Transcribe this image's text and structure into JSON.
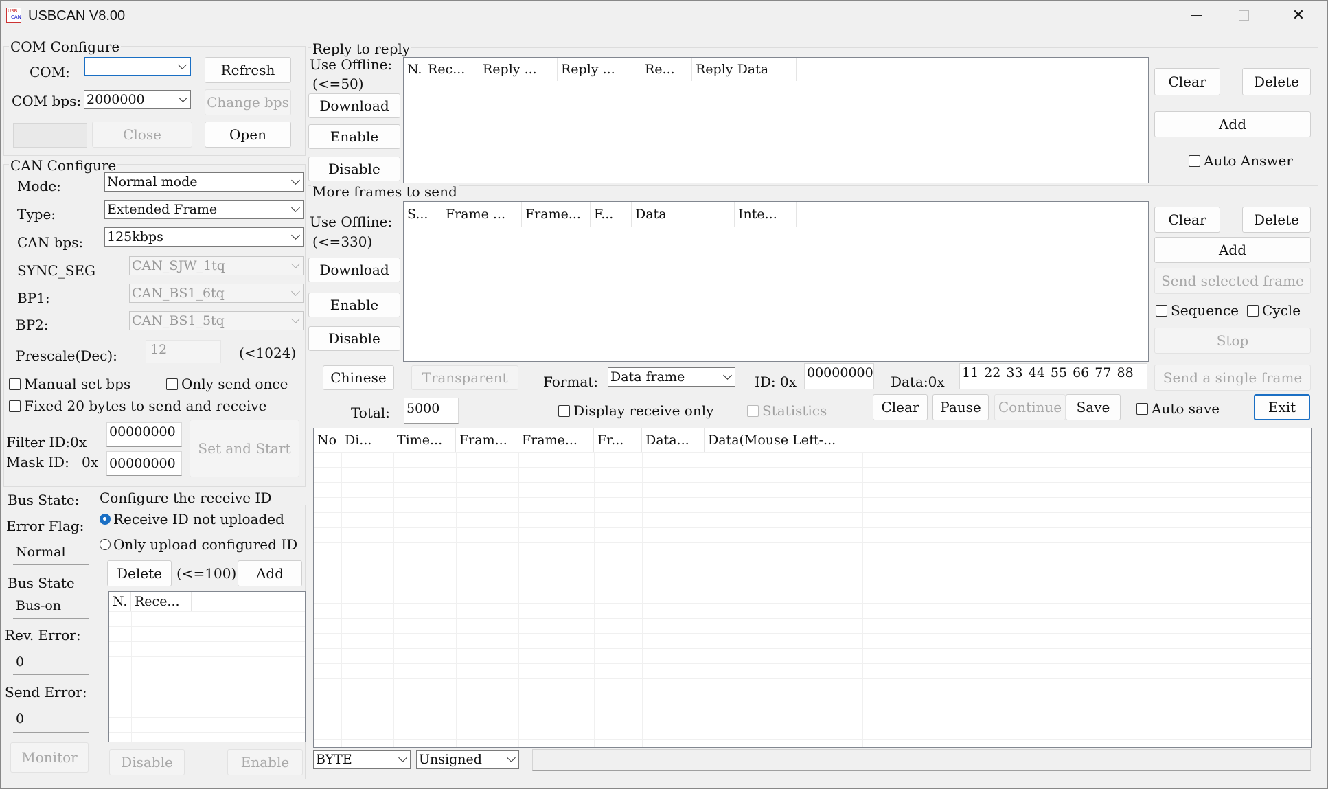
{
  "window": {
    "title": "USBCAN V8.00",
    "icon_text_top": "USB",
    "icon_text_bottom": "CAN",
    "minimize": "—",
    "maximize": "☐",
    "close": "✕"
  },
  "com": {
    "group": "COM Configure",
    "com_label": "COM:",
    "com_value": "",
    "refresh": "Refresh",
    "bps_label": "COM bps:",
    "bps_value": "2000000",
    "change_bps": "Change bps",
    "close": "Close",
    "open": "Open"
  },
  "can": {
    "group": "CAN Configure",
    "mode_label": "Mode:",
    "mode_value": "Normal mode",
    "type_label": "Type:",
    "type_value": "Extended Frame",
    "bps_label": "CAN bps:",
    "bps_value": "125kbps",
    "sync_label": "SYNC_SEG",
    "sync_value": "CAN_SJW_1tq",
    "bp1_label": "BP1:",
    "bp1_value": "CAN_BS1_6tq",
    "bp2_label": "BP2:",
    "bp2_value": "CAN_BS1_5tq",
    "prescale_label": "Prescale(Dec):",
    "prescale_value": "12",
    "prescale_hint": "(<1024)",
    "manual_bps": "Manual set bps",
    "only_once": "Only send once",
    "fixed20": "Fixed 20 bytes to send and receive",
    "filter_label": "Filter ID:0x",
    "filter_value": "00000000",
    "mask_label": "Mask ID:",
    "mask_prefix": "0x",
    "mask_value": "00000000",
    "set_start": "Set and Start"
  },
  "status": {
    "bus_state_label": "Bus State:",
    "error_flag_label": "Error Flag:",
    "error_flag_value": "Normal",
    "bus_state2_label": "Bus State",
    "bus_state_value": "Bus-on",
    "rev_error_label": "Rev. Error:",
    "rev_error_value": "0",
    "send_error_label": "Send Error:",
    "send_error_value": "0",
    "monitor": "Monitor"
  },
  "recv_id": {
    "group": "Configure the receive ID",
    "opt1": "Receive ID not uploaded",
    "opt2": "Only upload configured ID",
    "delete": "Delete",
    "hint": "(<=100)",
    "add": "Add",
    "columns": [
      "N.",
      "Rece..."
    ],
    "disable": "Disable",
    "enable": "Enable"
  },
  "reply": {
    "group": "Reply to reply",
    "offline": "Use Offline:",
    "hint": "(<=50)",
    "download": "Download",
    "enable": "Enable",
    "disable": "Disable",
    "columns": [
      "N.",
      "Rec...",
      "Reply ...",
      "Reply ...",
      "Re...",
      "Reply Data"
    ],
    "clear": "Clear",
    "delete": "Delete",
    "add": "Add",
    "auto_answer": "Auto Answer"
  },
  "frames": {
    "group": "More frames to send",
    "offline": "Use Offline:",
    "hint": "(<=330)",
    "download": "Download",
    "enable": "Enable",
    "disable": "Disable",
    "columns": [
      "S...",
      "Frame ...",
      "Frame...",
      "F...",
      "Data",
      "Inte..."
    ],
    "clear": "Clear",
    "delete": "Delete",
    "add": "Add",
    "send_selected": "Send selected frame",
    "sequence": "Sequence",
    "cycle": "Cycle",
    "stop": "Stop"
  },
  "single": {
    "chinese": "Chinese",
    "transparent": "Transparent",
    "format_label": "Format:",
    "format_value": "Data frame",
    "id_label": "ID: 0x",
    "id_value": "00000000",
    "data_label": "Data:0x",
    "data_value": "11 22 33 44 55 66 77 88",
    "send_single": "Send a single frame"
  },
  "recv": {
    "total_label": "Total:",
    "total_value": "5000",
    "display_only": "Display receive only",
    "statistics": "Statistics",
    "clear": "Clear",
    "pause": "Pause",
    "continue": "Continue",
    "save": "Save",
    "auto_save": "Auto save",
    "exit": "Exit",
    "columns": [
      "No",
      "Di...",
      "Time...",
      "Fram...",
      "Frame...",
      "Fr...",
      "Data...",
      "Data(Mouse Left-..."
    ],
    "unit_value": "BYTE",
    "sign_value": "Unsigned"
  }
}
